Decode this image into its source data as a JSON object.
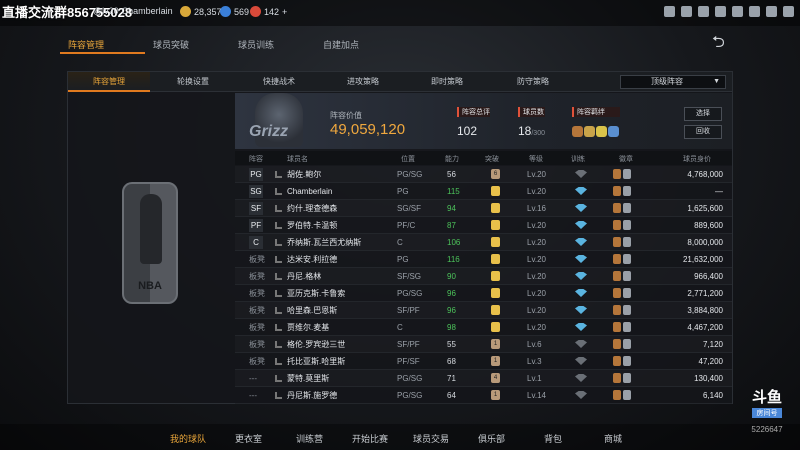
{
  "watermark": "直播交流群856755028",
  "top": {
    "level": "@lv20",
    "player": "Chamberlain",
    "coins": "28,357",
    "vc": "569",
    "tokens": "142",
    "plus": "+"
  },
  "subtabs": [
    "阵容管理",
    "球员突破",
    "球员训练",
    "自建加点"
  ],
  "panel_tabs": [
    "阵容管理",
    "轮换设置",
    "快捷战术",
    "进攻策略",
    "即时策略",
    "防守策略"
  ],
  "dropdown": "顶级阵容",
  "summary": {
    "team": "Grizz",
    "value_label": "阵容价值",
    "value": "49,059,120",
    "total_label": "阵容总评",
    "total": "102",
    "count_label": "球员数",
    "count": "18",
    "count_max": "/300",
    "bond_label": "阵容羁绊",
    "btn1": "选择",
    "btn2": "回收"
  },
  "headers": [
    "阵容",
    "球员名",
    "位置",
    "能力",
    "突破",
    "等级",
    "训练",
    "徽章",
    "球员身价"
  ],
  "rows": [
    {
      "slot": "PG",
      "name": "胡佐.鲍尔",
      "pos": "PG/SG",
      "ovr": "56",
      "brk": "6",
      "lv": "Lv.20",
      "val": "4,768,000"
    },
    {
      "slot": "SG",
      "name": "Chamberlain",
      "pos": "PG",
      "ovr": "115",
      "brk": "",
      "lv": "Lv.20",
      "val": "—"
    },
    {
      "slot": "SF",
      "name": "约什.理查德森",
      "pos": "SG/SF",
      "ovr": "94",
      "brk": "",
      "lv": "Lv.16",
      "val": "1,625,600"
    },
    {
      "slot": "PF",
      "name": "罗伯特.卡温顿",
      "pos": "PF/C",
      "ovr": "87",
      "brk": "",
      "lv": "Lv.20",
      "val": "889,600"
    },
    {
      "slot": "C",
      "name": "乔纳斯.瓦兰西尤纳斯",
      "pos": "C",
      "ovr": "106",
      "brk": "",
      "lv": "Lv.20",
      "val": "8,000,000"
    },
    {
      "slot": "板凳",
      "name": "达米安.利拉德",
      "pos": "PG",
      "ovr": "116",
      "brk": "",
      "lv": "Lv.20",
      "val": "21,632,000"
    },
    {
      "slot": "板凳",
      "name": "丹尼.格林",
      "pos": "SF/SG",
      "ovr": "90",
      "brk": "",
      "lv": "Lv.20",
      "val": "966,400"
    },
    {
      "slot": "板凳",
      "name": "亚历克斯.卡鲁索",
      "pos": "PG/SG",
      "ovr": "96",
      "brk": "",
      "lv": "Lv.20",
      "val": "2,771,200"
    },
    {
      "slot": "板凳",
      "name": "哈里森.巴恩斯",
      "pos": "SF/PF",
      "ovr": "96",
      "brk": "",
      "lv": "Lv.20",
      "val": "3,884,800"
    },
    {
      "slot": "板凳",
      "name": "贾维尔.麦基",
      "pos": "C",
      "ovr": "98",
      "brk": "",
      "lv": "Lv.20",
      "val": "4,467,200"
    },
    {
      "slot": "板凳",
      "name": "格伦.罗宾逊三世",
      "pos": "SF/PF",
      "ovr": "55",
      "brk": "1",
      "lv": "Lv.6",
      "val": "7,120"
    },
    {
      "slot": "板凳",
      "name": "托比亚斯.哈里斯",
      "pos": "PF/SF",
      "ovr": "68",
      "brk": "1",
      "lv": "Lv.3",
      "val": "47,200"
    },
    {
      "slot": "---",
      "name": "蒙特.莫里斯",
      "pos": "PG/SG",
      "ovr": "71",
      "brk": "4",
      "lv": "Lv.1",
      "val": "130,400"
    },
    {
      "slot": "---",
      "name": "丹尼斯.施罗德",
      "pos": "PG/SG",
      "ovr": "64",
      "brk": "1",
      "lv": "Lv.14",
      "val": "6,140"
    }
  ],
  "nav": [
    "我的球队",
    "更衣室",
    "训练营",
    "开始比赛",
    "球员交易",
    "俱乐部",
    "背包",
    "商城"
  ],
  "douyu": {
    "brand": "斗鱼",
    "room_label": "房间号",
    "room": "5226647"
  },
  "colors": {
    "accent": "#e8a53a",
    "green": "#4cc25a",
    "tier": "#e8a53a"
  }
}
